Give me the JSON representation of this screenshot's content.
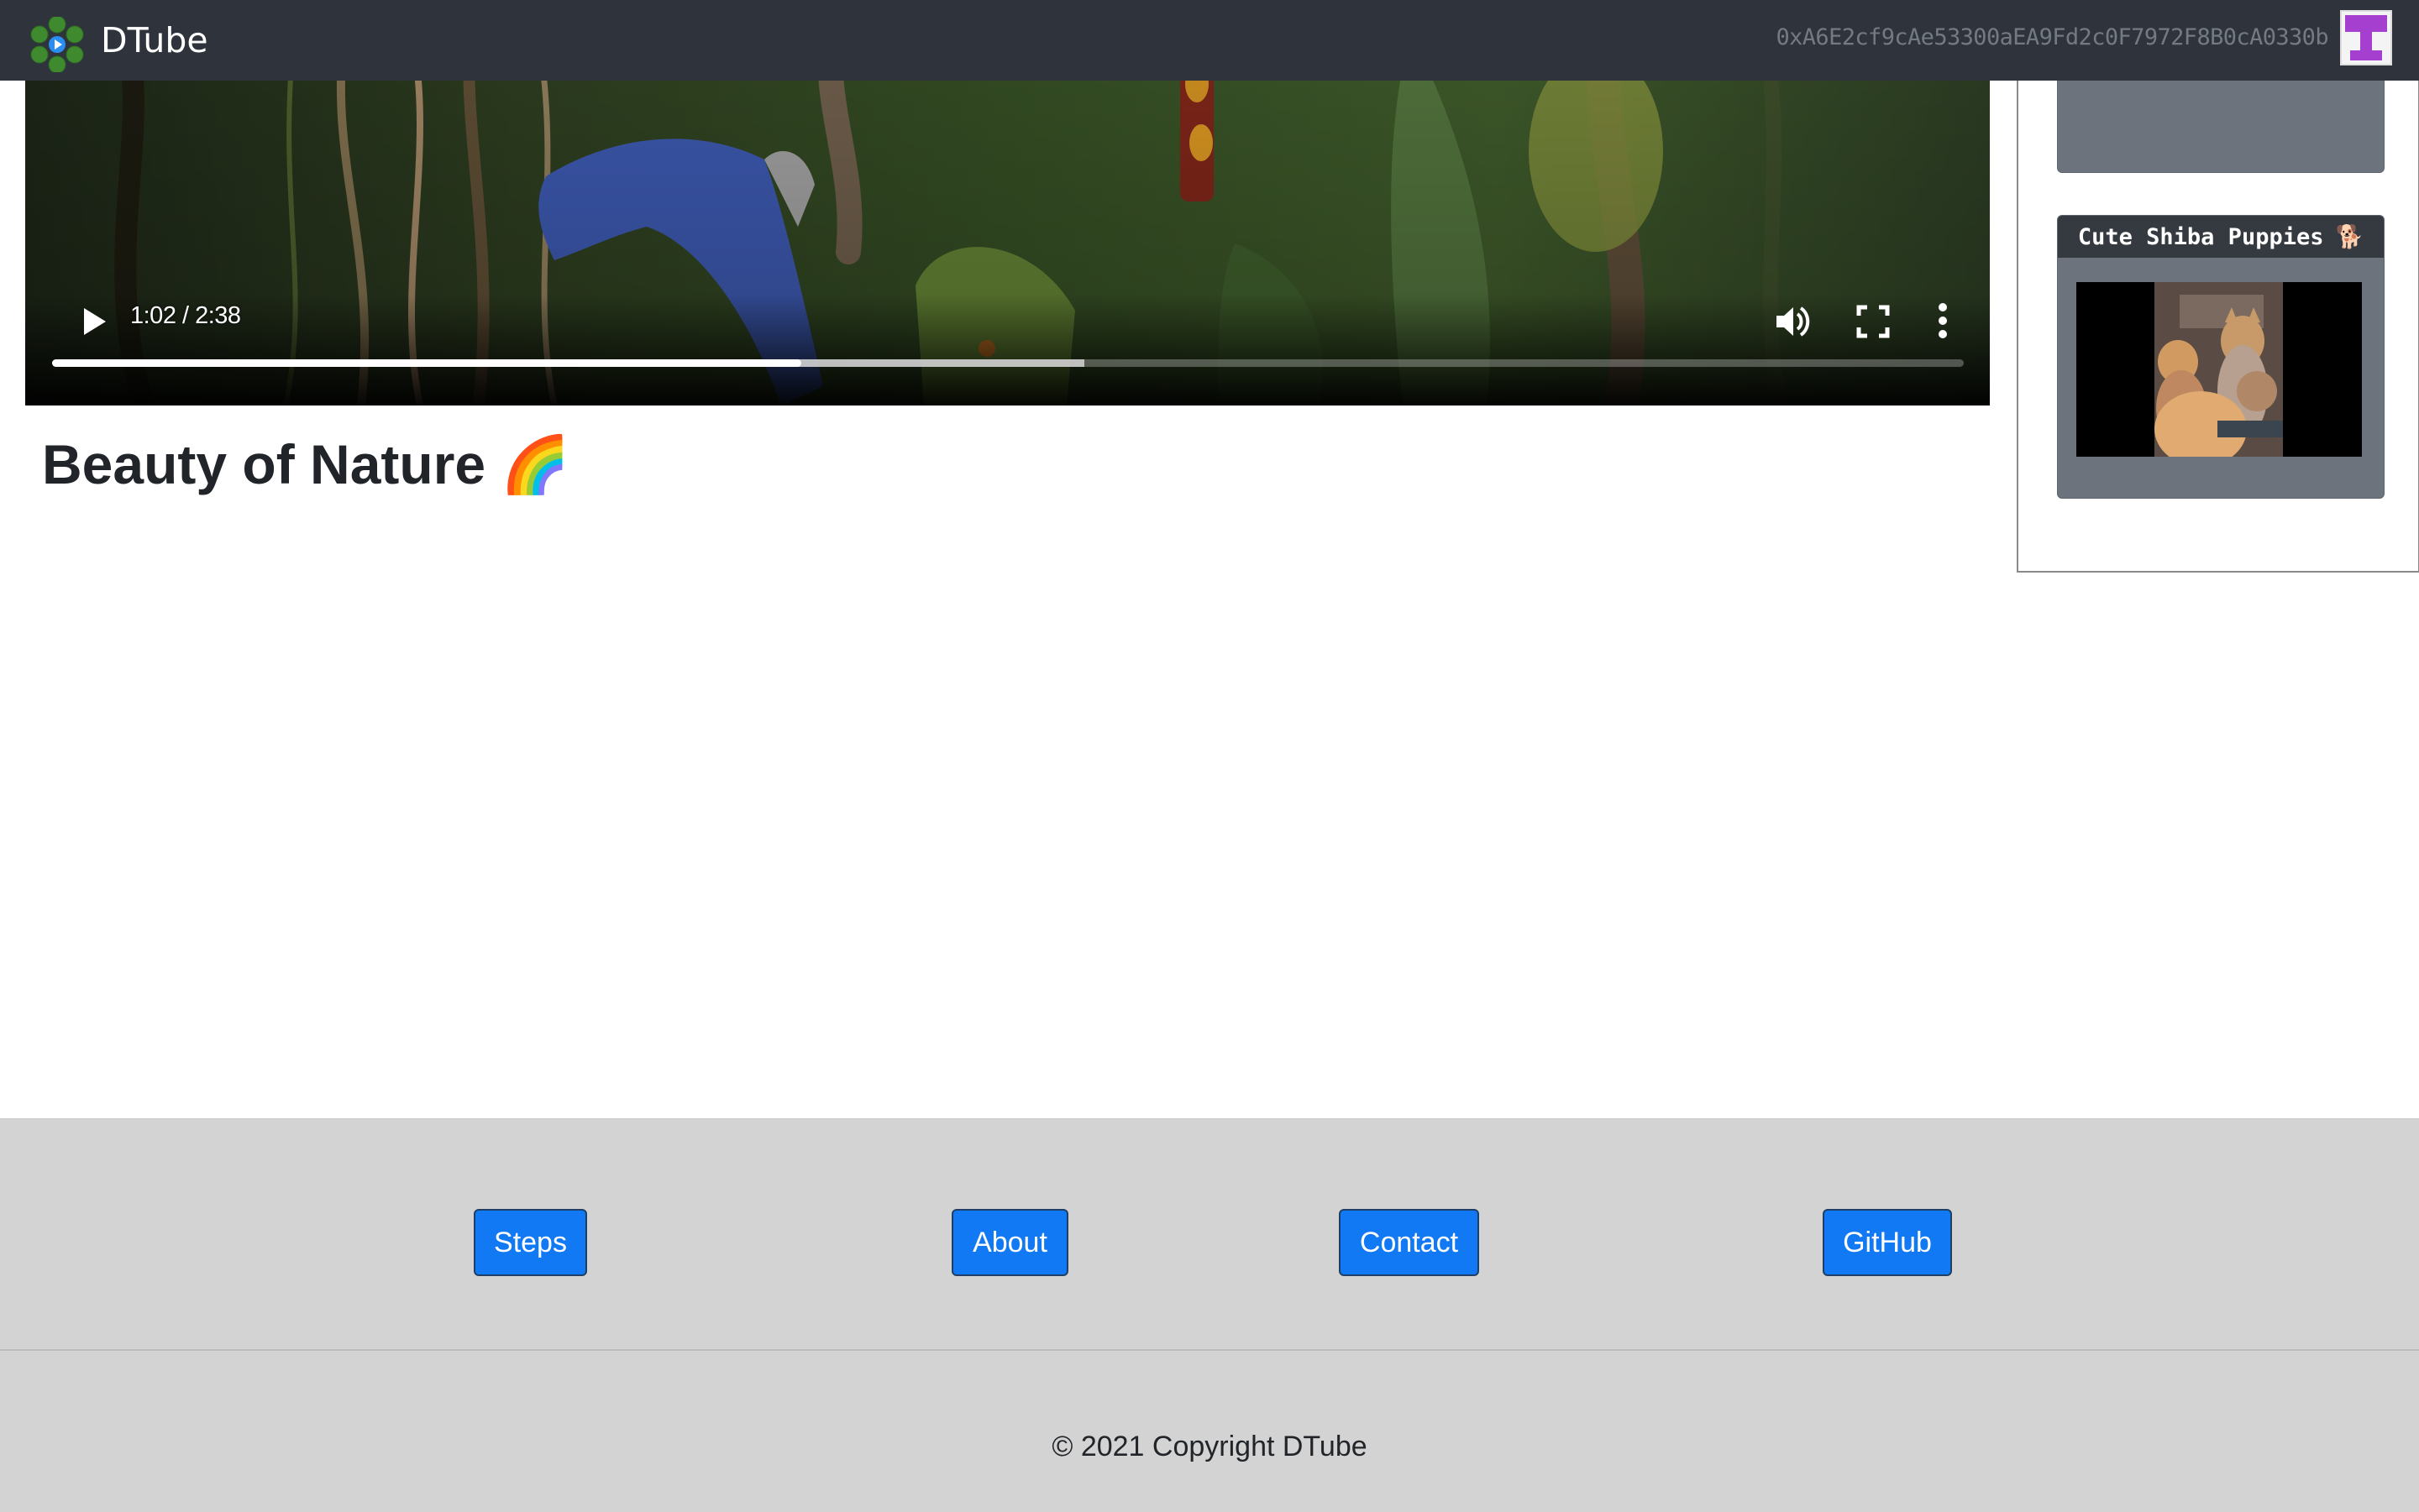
{
  "navbar": {
    "brand": "DTube",
    "logo_icon": "dtube-hexagon-play-logo-icon",
    "account_address": "0xA6E2cf9cAe53300aEA9Fd2c0F7972F8B0cA0330b",
    "avatar_icon": "identicon-avatar"
  },
  "player": {
    "current_time": "1:02",
    "duration": "2:38",
    "time_display": "1:02 / 2:38",
    "played_fraction": 0.392,
    "buffered_fraction": 0.54,
    "icons": [
      "play-icon",
      "volume-icon",
      "fullscreen-icon",
      "more-options-icon"
    ]
  },
  "video": {
    "title": "Beauty of Nature 🌈"
  },
  "sidebar": {
    "cards": [
      {
        "title": "",
        "thumb_color": "#f2c4d6"
      },
      {
        "title": "Cute Shiba Puppies",
        "emoji": "🐕"
      }
    ]
  },
  "footer": {
    "buttons": [
      {
        "label": "Steps"
      },
      {
        "label": "About"
      },
      {
        "label": "Contact"
      },
      {
        "label": "GitHub"
      }
    ],
    "copyright": "© 2021 Copyright DTube",
    "button_color": "#1279f4",
    "background": "#d3d3d3"
  }
}
